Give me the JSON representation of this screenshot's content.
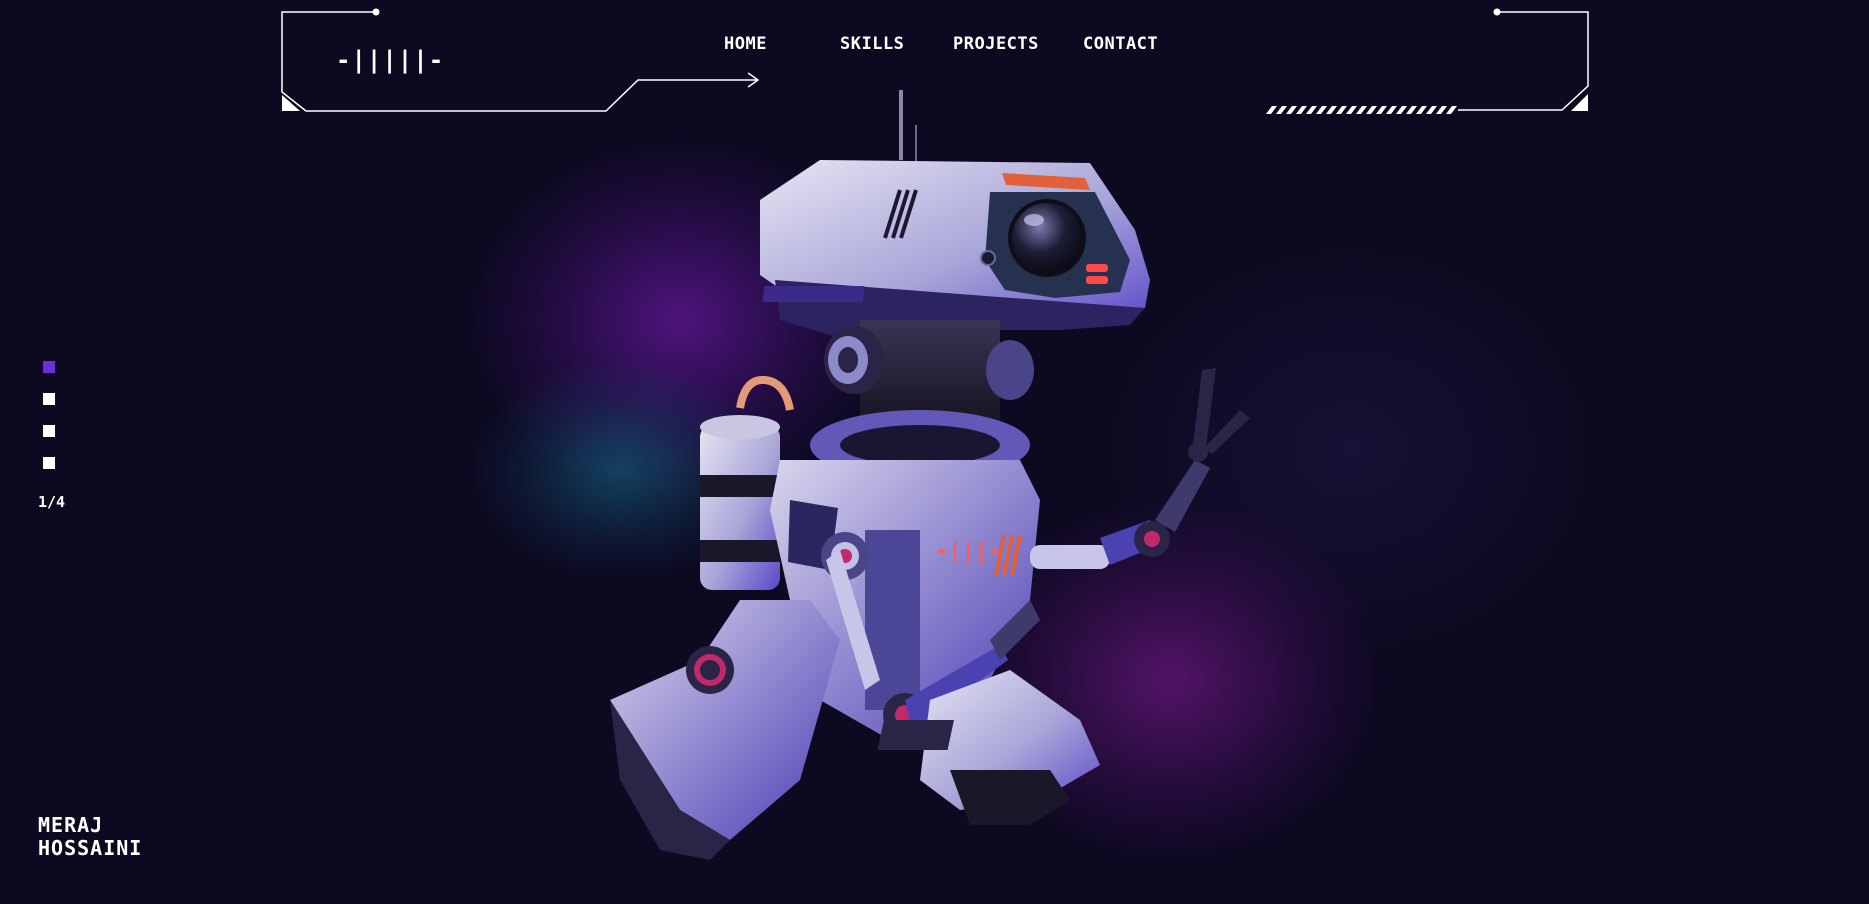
{
  "header": {
    "logo_text": "-|||||-",
    "nav": [
      {
        "label": "HOME"
      },
      {
        "label": "SKILLS"
      },
      {
        "label": "PROJECTS"
      },
      {
        "label": "CONTACT"
      }
    ]
  },
  "slider": {
    "active_index": 1,
    "total": 4,
    "counter_text": "1/4",
    "active_color": "#6a2fd6",
    "inactive_color": "#ffffff"
  },
  "robot": {
    "chest_logo": "-|||-"
  },
  "author": {
    "first_name": "MERAJ",
    "last_name": "HOSSAINI"
  },
  "colors": {
    "background": "#0c0920",
    "accent_purple": "#6a2fd6",
    "glow_magenta": "#9a1eaa",
    "glow_teal": "#146e8c",
    "robot_light_red": "#ff4a4a"
  }
}
